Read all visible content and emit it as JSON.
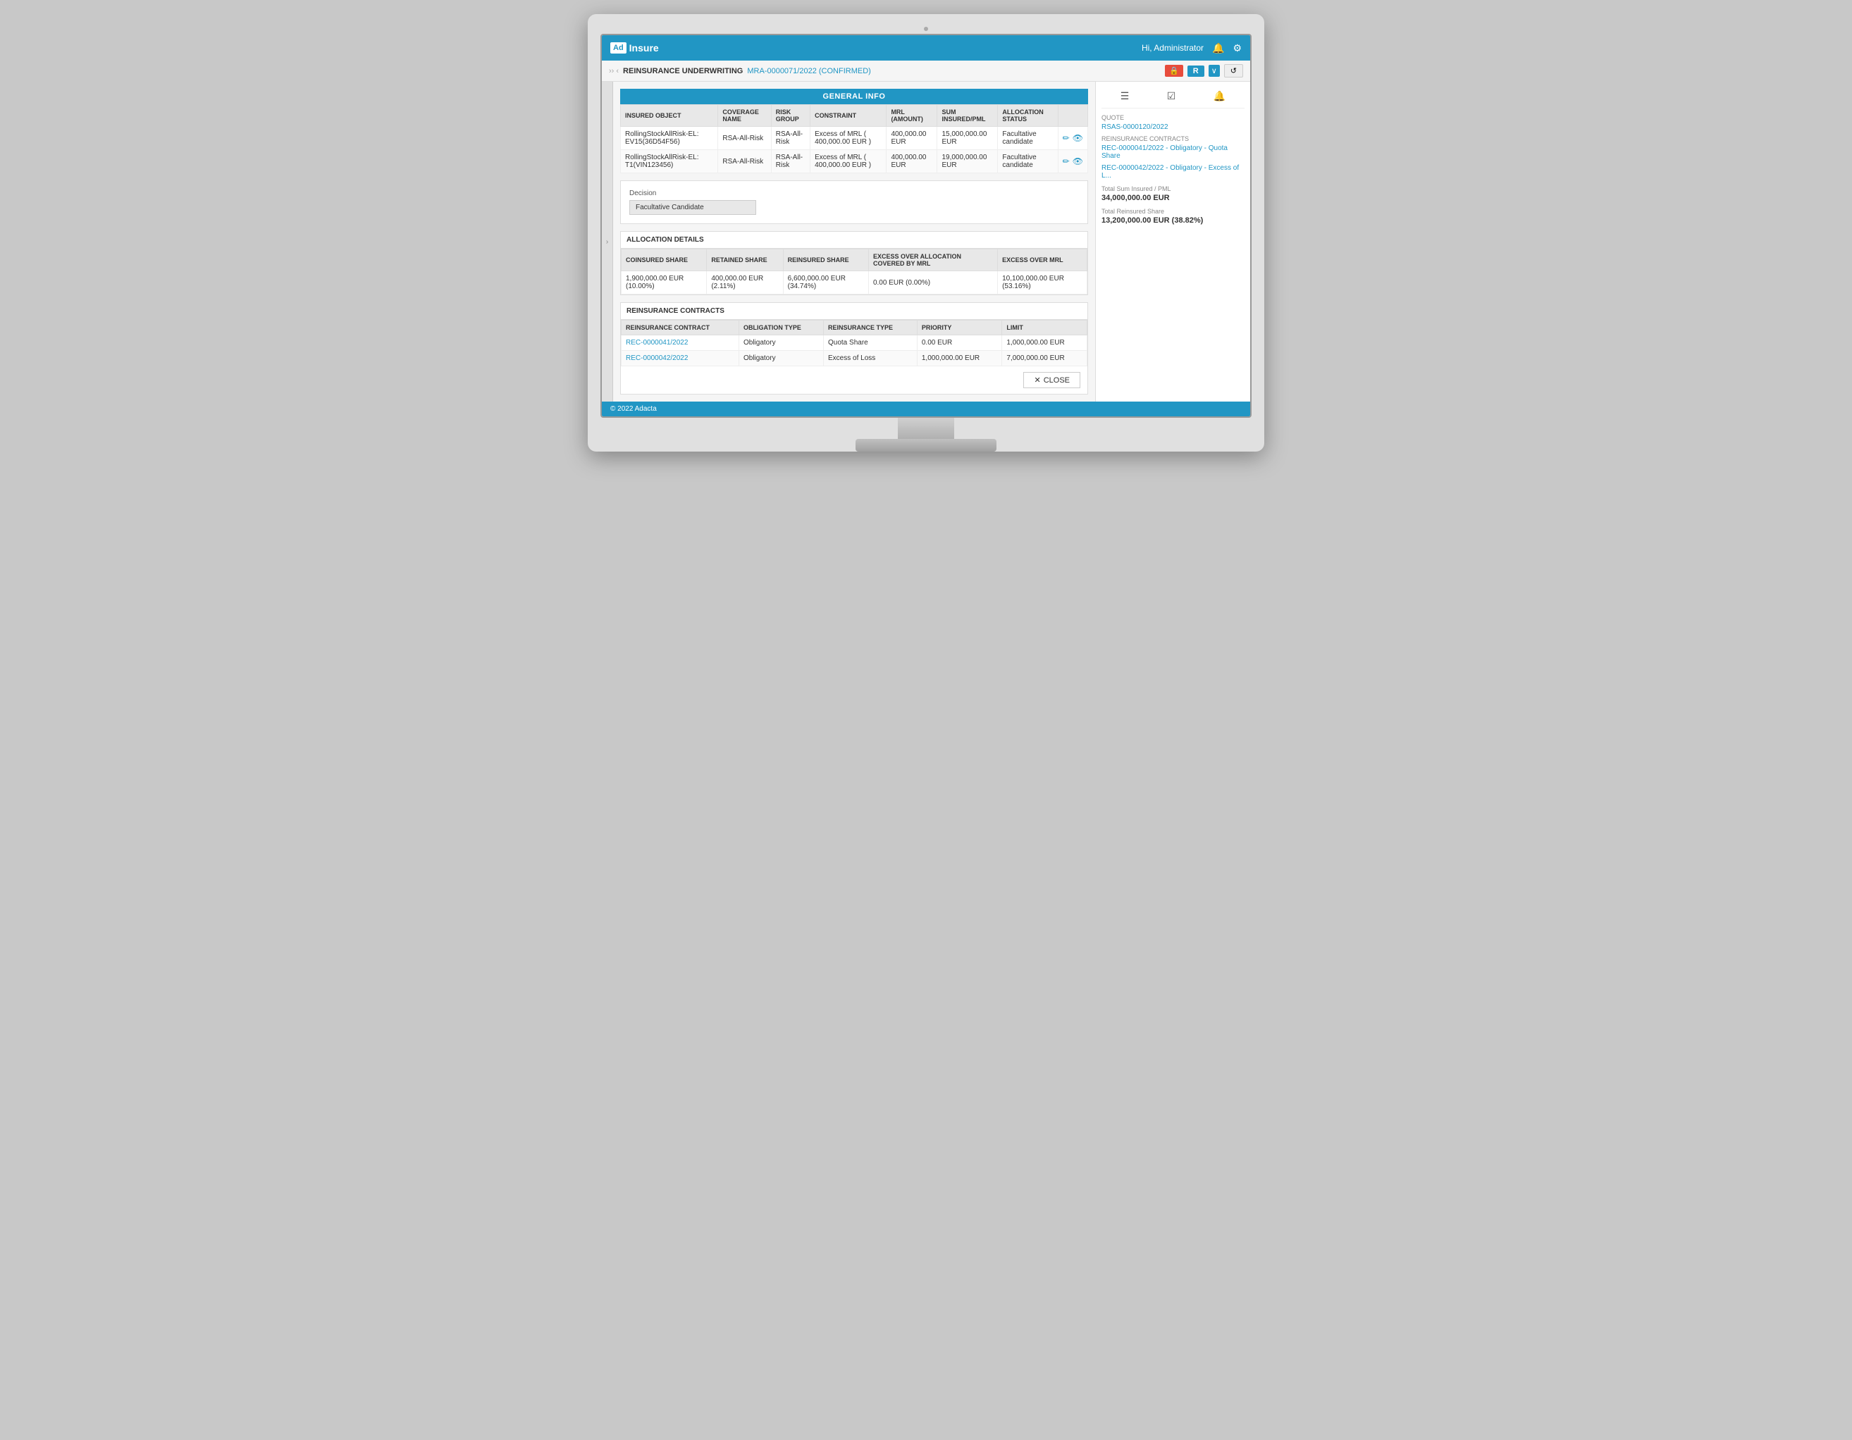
{
  "app": {
    "logo_prefix": "Ad",
    "logo_suffix": "Insure",
    "user": "Hi, Administrator",
    "footer": "© 2022 Adacta"
  },
  "breadcrumb": {
    "back": "‹",
    "module": "REINSURANCE UNDERWRITING",
    "record_id": "MRA-0000071/2022 (CONFIRMED)"
  },
  "toolbar": {
    "lock_icon": "🔒",
    "r_button": "R",
    "dropdown": "∨",
    "refresh_icon": "↺"
  },
  "general_info": {
    "section_title": "GENERAL INFO",
    "table_headers": [
      "INSURED OBJECT",
      "COVERAGE NAME",
      "RISK GROUP",
      "CONSTRAINT",
      "MRL (AMOUNT)",
      "SUM INSURED/PML",
      "ALLOCATION STATUS"
    ],
    "rows": [
      {
        "insured_object": "RollingStockAllRisk-EL: EV15(36D54F56)",
        "coverage_name": "RSA-All-Risk",
        "risk_group": "RSA-All-Risk",
        "constraint": "Excess of MRL ( 400,000.00 EUR )",
        "mrl_amount": "400,000.00 EUR",
        "sum_insured": "15,000,000.00 EUR",
        "allocation_status": "Facultative candidate"
      },
      {
        "insured_object": "RollingStockAllRisk-EL: T1(VIN123456)",
        "coverage_name": "RSA-All-Risk",
        "risk_group": "RSA-All-Risk",
        "constraint": "Excess of MRL ( 400,000.00 EUR )",
        "mrl_amount": "400,000.00 EUR",
        "sum_insured": "19,000,000.00 EUR",
        "allocation_status": "Facultative candidate"
      }
    ]
  },
  "decision": {
    "label": "Decision",
    "value": "Facultative Candidate"
  },
  "allocation_details": {
    "title": "ALLOCATION DETAILS",
    "headers": [
      "COINSURED SHARE",
      "RETAINED SHARE",
      "REINSURED SHARE",
      "EXCESS OVER ALLOCATION COVERED BY MRL",
      "EXCESS OVER MRL"
    ],
    "rows": [
      {
        "coinsured_share": "1,900,000.00 EUR (10.00%)",
        "retained_share": "400,000.00 EUR (2.11%)",
        "reinsured_share": "6,600,000.00 EUR (34.74%)",
        "excess_over_alloc": "0.00 EUR (0.00%)",
        "excess_over_mrl": "10,100,000.00 EUR (53.16%)"
      }
    ]
  },
  "reinsurance_contracts": {
    "title": "REINSURANCE CONTRACTS",
    "headers": [
      "REINSURANCE CONTRACT",
      "OBLIGATION TYPE",
      "REINSURANCE TYPE",
      "PRIORITY",
      "LIMIT"
    ],
    "rows": [
      {
        "contract": "REC-0000041/2022",
        "obligation_type": "Obligatory",
        "reinsurance_type": "Quota Share",
        "priority": "0.00 EUR",
        "limit": "1,000,000.00 EUR"
      },
      {
        "contract": "REC-0000042/2022",
        "obligation_type": "Obligatory",
        "reinsurance_type": "Excess of Loss",
        "priority": "1,000,000.00 EUR",
        "limit": "7,000,000.00 EUR"
      }
    ]
  },
  "close_button": "CLOSE",
  "sidebar": {
    "quote_label": "Quote",
    "quote_link": "RSAS-0000120/2022",
    "contracts_label": "REINSURANCE CONTRACTS",
    "contract_links": [
      "REC-0000041/2022 - Obligatory - Quota Share",
      "REC-0000042/2022 - Obligatory - Excess of L..."
    ],
    "total_sum_label": "Total Sum Insured / PML",
    "total_sum_value": "34,000,000.00 EUR",
    "total_reinsured_label": "Total Reinsured Share",
    "total_reinsured_value": "13,200,000.00 EUR (38.82%)"
  }
}
